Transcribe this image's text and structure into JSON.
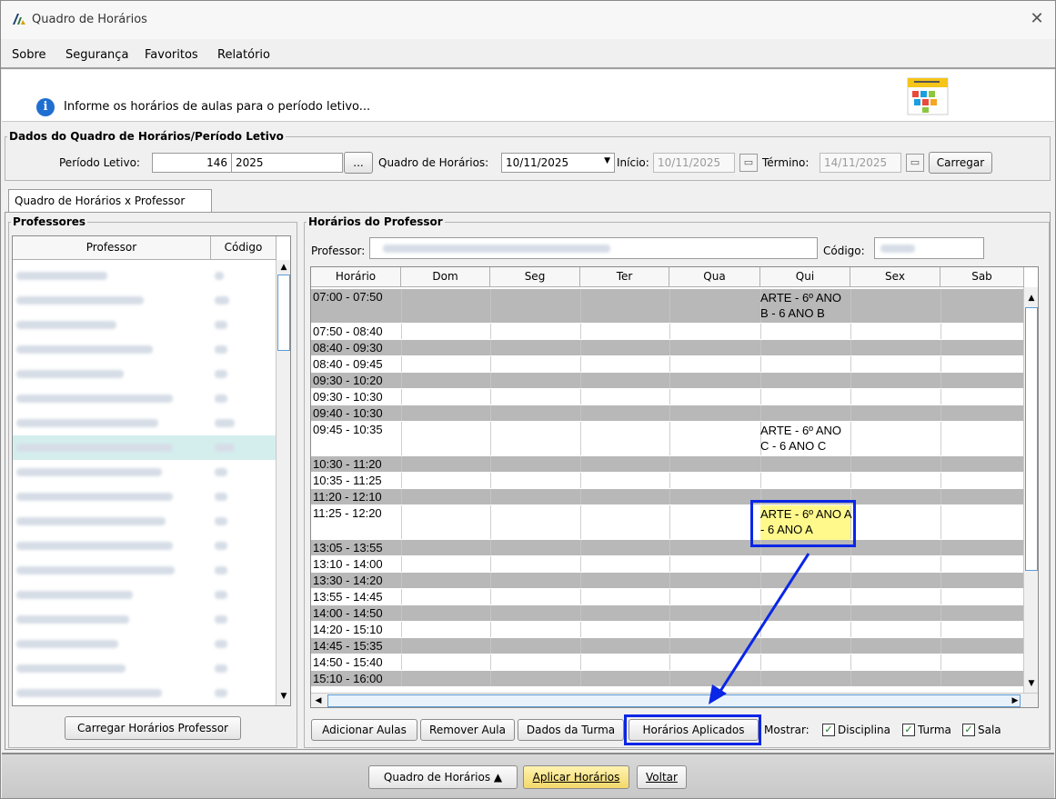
{
  "window": {
    "title": "Quadro de Horários",
    "close": "✕"
  },
  "menu": {
    "items": [
      "Sobre",
      "Segurança",
      "Favoritos",
      "Relatório"
    ]
  },
  "info": {
    "message": "Informe os horários de aulas para o período letivo..."
  },
  "dados": {
    "legend": "Dados do Quadro de Horários/Período Letivo",
    "periodo_label": "Período Letivo:",
    "periodo_code": "146",
    "periodo_year": "2025",
    "ellipsis": "...",
    "quadro_label": "Quadro de Horários:",
    "quadro_value": "10/11/2025",
    "inicio_label": "Início:",
    "inicio_value": "10/11/2025",
    "termino_label": "Término:",
    "termino_value": "14/11/2025",
    "carregar": "Carregar"
  },
  "tab": {
    "label": "Quadro de Horários x Professor"
  },
  "professores": {
    "legend": "Professores",
    "col_professor": "Professor",
    "col_codigo": "Código",
    "carregar_btn": "Carregar Horários Professor"
  },
  "horarios": {
    "legend": "Horários do Professor",
    "professor_label": "Professor:",
    "codigo_label": "Código:",
    "columns": [
      "Horário",
      "Dom",
      "Seg",
      "Ter",
      "Qua",
      "Qui",
      "Sex",
      "Sab"
    ],
    "rows": [
      {
        "time": "07:00 - 07:50",
        "qui": "ARTE - 6º ANO B - 6 ANO B"
      },
      {
        "time": "07:50 - 08:40",
        "qui": ""
      },
      {
        "time": "08:40 - 09:30",
        "qui": ""
      },
      {
        "time": "08:40 - 09:45",
        "qui": ""
      },
      {
        "time": "09:30 - 10:20",
        "qui": ""
      },
      {
        "time": "09:30 - 10:30",
        "qui": ""
      },
      {
        "time": "09:40 - 10:30",
        "qui": ""
      },
      {
        "time": "09:45 - 10:35",
        "qui": "ARTE - 6º ANO C - 6 ANO C"
      },
      {
        "time": "10:30 - 11:20",
        "qui": ""
      },
      {
        "time": "10:35 - 11:25",
        "qui": ""
      },
      {
        "time": "11:20 - 12:10",
        "qui": ""
      },
      {
        "time": "11:25 - 12:20",
        "qui": "ARTE - 6º ANO A - 6 ANO A"
      },
      {
        "time": "13:05 - 13:55",
        "qui": ""
      },
      {
        "time": "13:10 - 14:00",
        "qui": ""
      },
      {
        "time": "13:30 - 14:20",
        "qui": ""
      },
      {
        "time": "13:55 - 14:45",
        "qui": ""
      },
      {
        "time": "14:00 - 14:50",
        "qui": ""
      },
      {
        "time": "14:20 - 15:10",
        "qui": ""
      },
      {
        "time": "14:45 - 15:35",
        "qui": ""
      },
      {
        "time": "14:50 - 15:40",
        "qui": ""
      },
      {
        "time": "15:10 - 16:00",
        "qui": ""
      }
    ]
  },
  "actions": {
    "adicionar": "Adicionar Aulas",
    "remover": "Remover Aula",
    "dados_turma": "Dados da Turma",
    "horarios_aplicados": "Horários Aplicados",
    "mostrar": "Mostrar:",
    "disciplina": "Disciplina",
    "turma": "Turma",
    "sala": "Sala"
  },
  "bottom": {
    "quadro_btn": "Quadro de Horários ▲",
    "aplicar_btn": "Aplicar Horários",
    "voltar_btn": "Voltar"
  },
  "colors": {
    "highlight_border": "#0a26e6",
    "highlight_fill": "#fff98c",
    "gray_row": "#b8b8b8",
    "selected_row": "#d4eeee"
  }
}
